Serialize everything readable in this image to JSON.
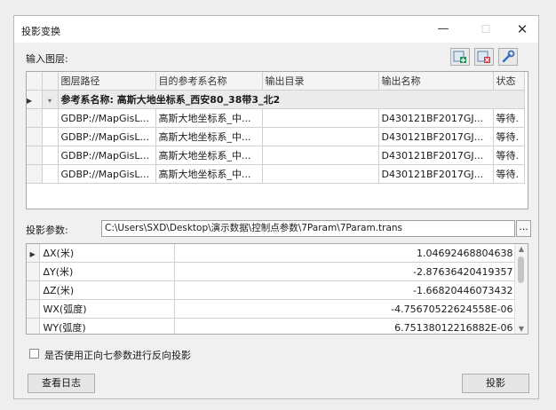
{
  "window": {
    "title": "投影变换",
    "min_glyph": "—",
    "max_glyph": "☐",
    "close_glyph": "✕"
  },
  "input_layers": {
    "label": "输入图层:",
    "columns": [
      "图层路径",
      "目的参考系名称",
      "输出目录",
      "输出名称",
      "状态"
    ],
    "group_label": "参考系名称: 高斯大地坐标系_西安80_38带3_北2",
    "rows": [
      {
        "path": "GDBP://MapGisL...",
        "ref": "高斯大地坐标系_中...",
        "outdir": "",
        "outname": "D430121BF2017GJ...",
        "status": "等待."
      },
      {
        "path": "GDBP://MapGisL...",
        "ref": "高斯大地坐标系_中...",
        "outdir": "",
        "outname": "D430121BF2017GJ...",
        "status": "等待."
      },
      {
        "path": "GDBP://MapGisL...",
        "ref": "高斯大地坐标系_中...",
        "outdir": "",
        "outname": "D430121BF2017GJ...",
        "status": "等待."
      },
      {
        "path": "GDBP://MapGisL...",
        "ref": "高斯大地坐标系_中...",
        "outdir": "",
        "outname": "D430121BF2017GJ...",
        "status": "等待."
      }
    ]
  },
  "projection_params": {
    "label": "投影参数:",
    "path": "C:\\Users\\SXD\\Desktop\\演示数据\\控制点参数\\7Param\\7Param.trans",
    "browse_glyph": "...",
    "rows": [
      {
        "name": "ΔX(米)",
        "value": "1.04692468804638"
      },
      {
        "name": "ΔY(米)",
        "value": "-2.87636420419357"
      },
      {
        "name": "ΔZ(米)",
        "value": "-1.66820446073432"
      },
      {
        "name": "WX(弧度)",
        "value": "-4.75670522624558E-06"
      },
      {
        "name": "WY(弧度)",
        "value": "6.75138012216882E-06"
      }
    ]
  },
  "reverse_checkbox_label": "是否使用正向七参数进行反向投影",
  "buttons": {
    "view_log": "查看日志",
    "project": "投影"
  },
  "colors": {
    "add_icon": "#2e8b57",
    "remove_icon": "#d9363e",
    "tool_icon": "#3a6fb5"
  }
}
